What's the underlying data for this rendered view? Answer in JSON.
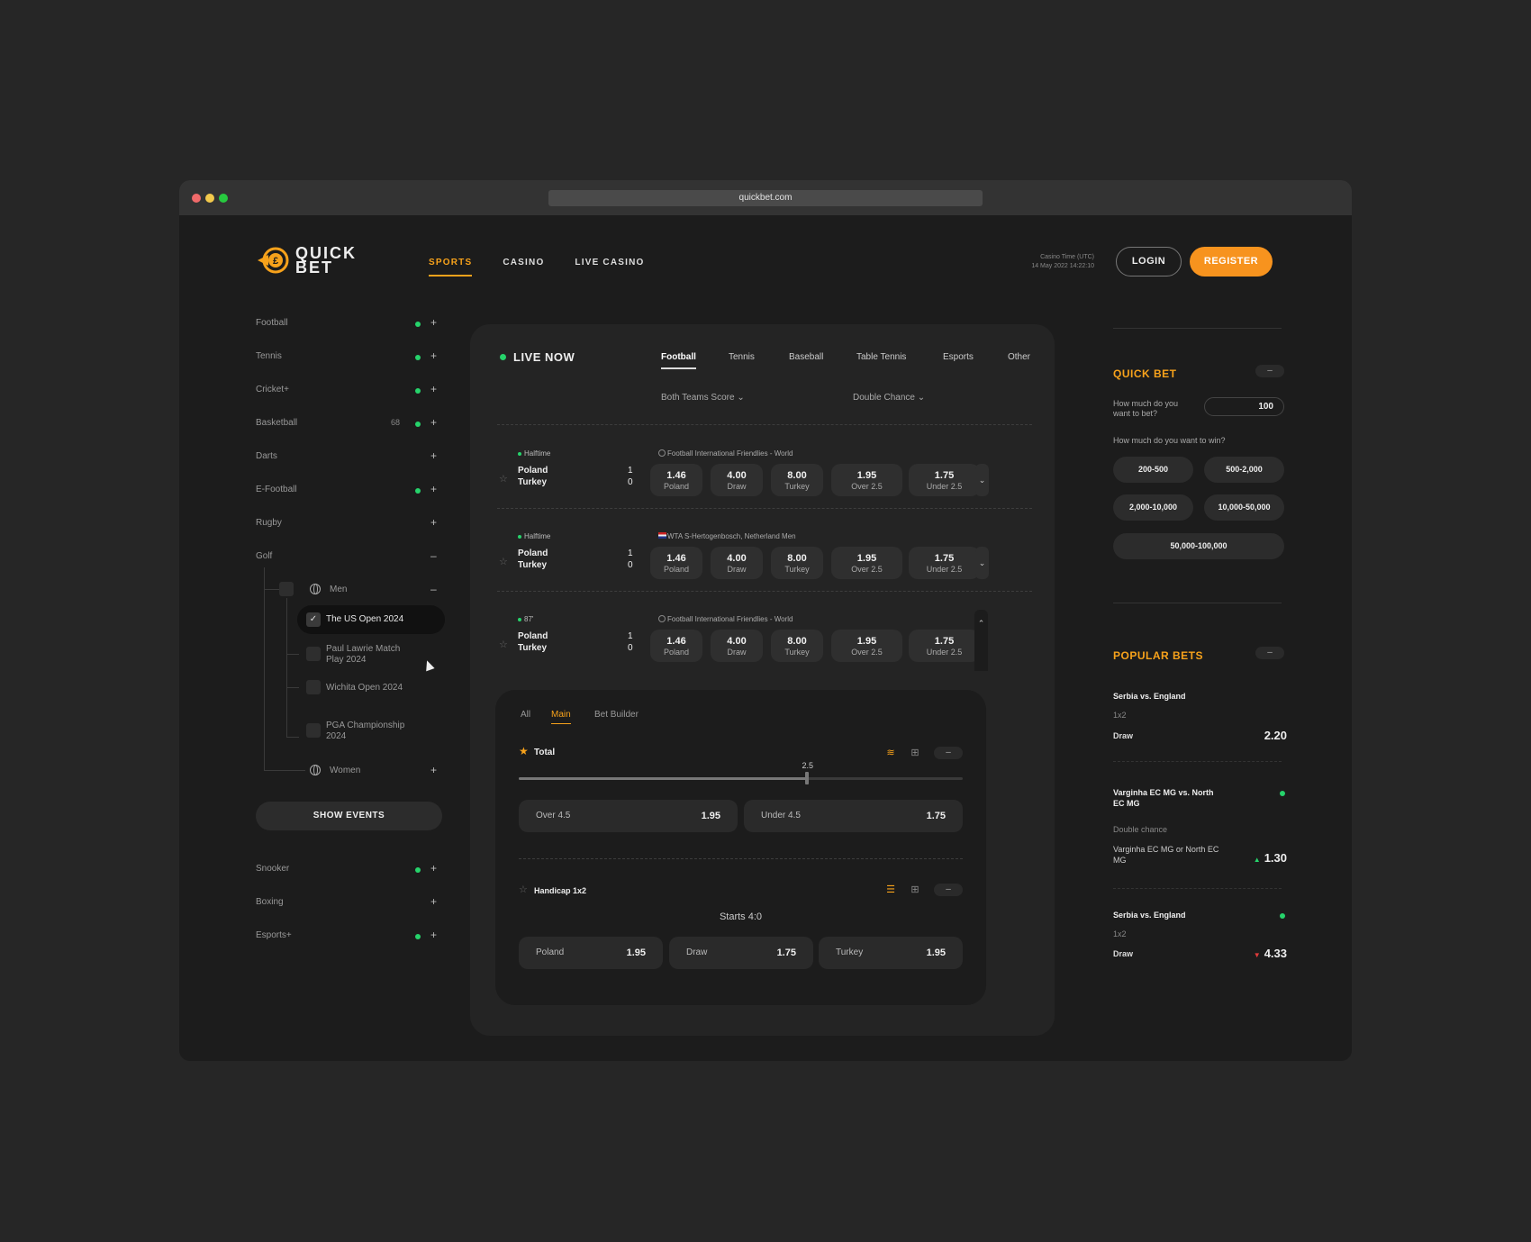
{
  "browser": {
    "url": "quickbet.com"
  },
  "brand": {
    "line1": "QUICK",
    "line2": "BET",
    "accent": "#f7a21b",
    "success": "#26d36b",
    "danger": "#e23b3b"
  },
  "nav": {
    "sports": "SPORTS",
    "casino": "CASINO",
    "live_casino": "LIVE CASINO"
  },
  "header": {
    "casino_time_label": "Casino Time (UTC)",
    "casino_time_value": "14 May 2022 14:22:10",
    "login": "LOGIN",
    "register": "REGISTER"
  },
  "sidebar": {
    "items": [
      {
        "label": "Football",
        "live": true,
        "toggle": "+"
      },
      {
        "label": "Tennis",
        "live": true,
        "toggle": "+"
      },
      {
        "label": "Cricket+",
        "live": true,
        "toggle": "+"
      },
      {
        "label": "Basketball",
        "count": "68",
        "live": true,
        "toggle": "+"
      },
      {
        "label": "Darts",
        "live": false,
        "toggle": "+"
      },
      {
        "label": "E-Football",
        "live": true,
        "toggle": "+"
      },
      {
        "label": "Rugby",
        "live": false,
        "toggle": "+"
      },
      {
        "label": "Golf",
        "live": false,
        "toggle": "–"
      }
    ],
    "golf": {
      "men": {
        "label": "Men",
        "toggle": "–"
      },
      "events": [
        "The US Open 2024",
        "Paul Lawrie Match Play 2024",
        "Wichita Open 2024",
        "PGA Championship 2024"
      ],
      "women": {
        "label": "Women",
        "toggle": "+"
      }
    },
    "show_events": "SHOW EVENTS",
    "bottom_items": [
      {
        "label": "Snooker",
        "live": true,
        "toggle": "+"
      },
      {
        "label": "Boxing",
        "live": false,
        "toggle": "+"
      },
      {
        "label": "Esports+",
        "live": true,
        "toggle": "+"
      }
    ]
  },
  "live": {
    "title": "LIVE NOW",
    "tabs": [
      "Football",
      "Tennis",
      "Baseball",
      "Table Tennis",
      "Esports",
      "Other"
    ],
    "filters": [
      "Both Teams Score",
      "Double Chance"
    ],
    "matches": [
      {
        "status": "Halftime",
        "league": "Football International Friendlies - World",
        "home": "Poland",
        "away": "Turkey",
        "home_score": "1",
        "away_score": "0",
        "odds": [
          {
            "v": "1.46",
            "l": "Poland"
          },
          {
            "v": "4.00",
            "l": "Draw"
          },
          {
            "v": "8.00",
            "l": "Turkey"
          },
          {
            "v": "1.95",
            "l": "Over 2.5"
          },
          {
            "v": "1.75",
            "l": "Under 2.5"
          }
        ]
      },
      {
        "status": "Halftime",
        "league": "WTA S-Hertogenbosch, Netherland Men",
        "home": "Poland",
        "away": "Turkey",
        "home_score": "1",
        "away_score": "0",
        "odds": [
          {
            "v": "1.46",
            "l": "Poland"
          },
          {
            "v": "4.00",
            "l": "Draw"
          },
          {
            "v": "8.00",
            "l": "Turkey"
          },
          {
            "v": "1.95",
            "l": "Over 2.5"
          },
          {
            "v": "1.75",
            "l": "Under 2.5"
          }
        ]
      },
      {
        "status": "87'",
        "league": "Football International Friendlies - World",
        "home": "Poland",
        "away": "Turkey",
        "home_score": "1",
        "away_score": "0",
        "odds": [
          {
            "v": "1.46",
            "l": "Poland"
          },
          {
            "v": "4.00",
            "l": "Draw"
          },
          {
            "v": "8.00",
            "l": "Turkey"
          },
          {
            "v": "1.95",
            "l": "Over 2.5"
          },
          {
            "v": "1.75",
            "l": "Under 2.5"
          }
        ]
      }
    ]
  },
  "detail": {
    "tabs": [
      "All",
      "Main",
      "Bet Builder"
    ],
    "total": {
      "title": "Total",
      "slider_value": "2.5",
      "slider_fraction": 0.65,
      "odds": [
        {
          "l": "Over 4.5",
          "v": "1.95"
        },
        {
          "l": "Under 4.5",
          "v": "1.75"
        }
      ]
    },
    "handicap": {
      "title": "Handicap 1x2",
      "starts": "Starts 4:0",
      "odds": [
        {
          "l": "Poland",
          "v": "1.95"
        },
        {
          "l": "Draw",
          "v": "1.75"
        },
        {
          "l": "Turkey",
          "v": "1.95"
        }
      ]
    }
  },
  "quick_bet": {
    "title": "QUICK BET",
    "how_much_bet": "How much do you want to bet?",
    "amount": "100",
    "how_much_win": "How much do you want to win?",
    "ranges": [
      "200-500",
      "500-2,000",
      "2,000-10,000",
      "10,000-50,000",
      "50,000-100,000"
    ]
  },
  "popular_bets": {
    "title": "POPULAR BETS",
    "bets": [
      {
        "match": "Serbia vs. England",
        "market": "1x2",
        "pick": "Draw",
        "odd": "2.20",
        "trend": ""
      },
      {
        "match": "Varginha EC MG vs. North EC MG",
        "market": "Double chance",
        "pick": "Varginha EC MG or North EC MG",
        "odd": "1.30",
        "trend": "▲"
      },
      {
        "match": "Serbia vs. England",
        "market": "1x2",
        "pick": "Draw",
        "odd": "4.33",
        "trend": "▼"
      }
    ]
  }
}
